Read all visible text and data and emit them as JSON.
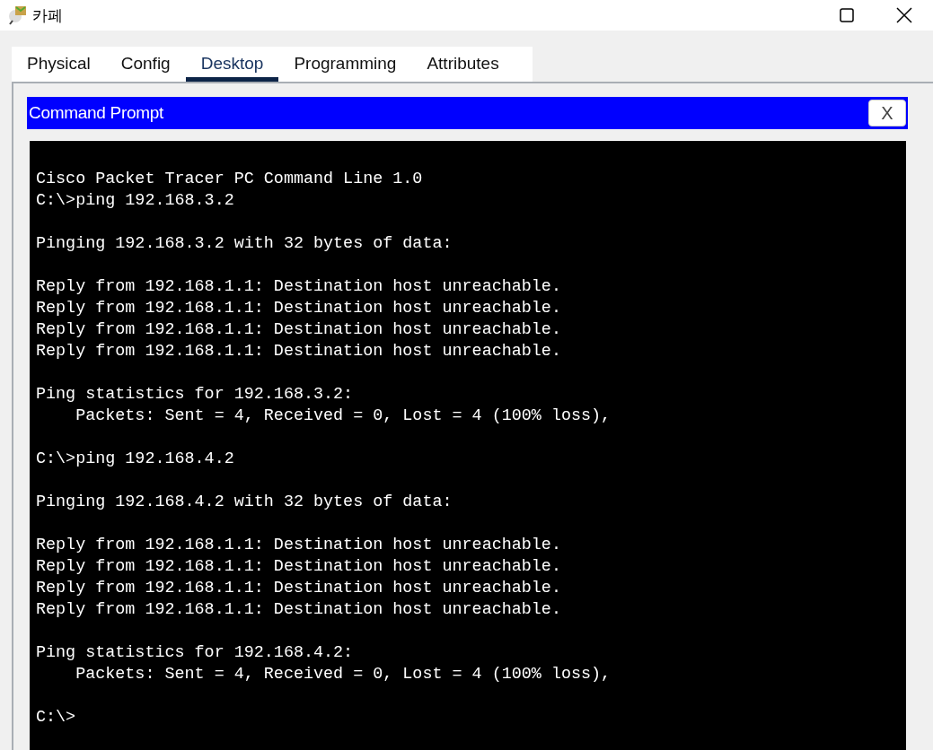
{
  "window": {
    "title": "카페"
  },
  "tabs": [
    {
      "label": "Physical",
      "selected": false
    },
    {
      "label": "Config",
      "selected": false
    },
    {
      "label": "Desktop",
      "selected": true
    },
    {
      "label": "Programming",
      "selected": false
    },
    {
      "label": "Attributes",
      "selected": false
    }
  ],
  "command_prompt": {
    "title": "Command Prompt",
    "close_label": "X",
    "blocks": [
      [
        "Cisco Packet Tracer PC Command Line 1.0",
        "C:\\>ping 192.168.3.2"
      ],
      [
        "Pinging 192.168.3.2 with 32 bytes of data:"
      ],
      [
        "Reply from 192.168.1.1: Destination host unreachable.",
        "Reply from 192.168.1.1: Destination host unreachable.",
        "Reply from 192.168.1.1: Destination host unreachable.",
        "Reply from 192.168.1.1: Destination host unreachable."
      ],
      [
        "Ping statistics for 192.168.3.2:",
        "    Packets: Sent = 4, Received = 0, Lost = 4 (100% loss),"
      ],
      [
        "C:\\>ping 192.168.4.2"
      ],
      [
        "Pinging 192.168.4.2 with 32 bytes of data:"
      ],
      [
        "Reply from 192.168.1.1: Destination host unreachable.",
        "Reply from 192.168.1.1: Destination host unreachable.",
        "Reply from 192.168.1.1: Destination host unreachable.",
        "Reply from 192.168.1.1: Destination host unreachable."
      ],
      [
        "Ping statistics for 192.168.4.2:",
        "    Packets: Sent = 4, Received = 0, Lost = 4 (100% loss),"
      ],
      [
        "C:\\>"
      ]
    ]
  }
}
